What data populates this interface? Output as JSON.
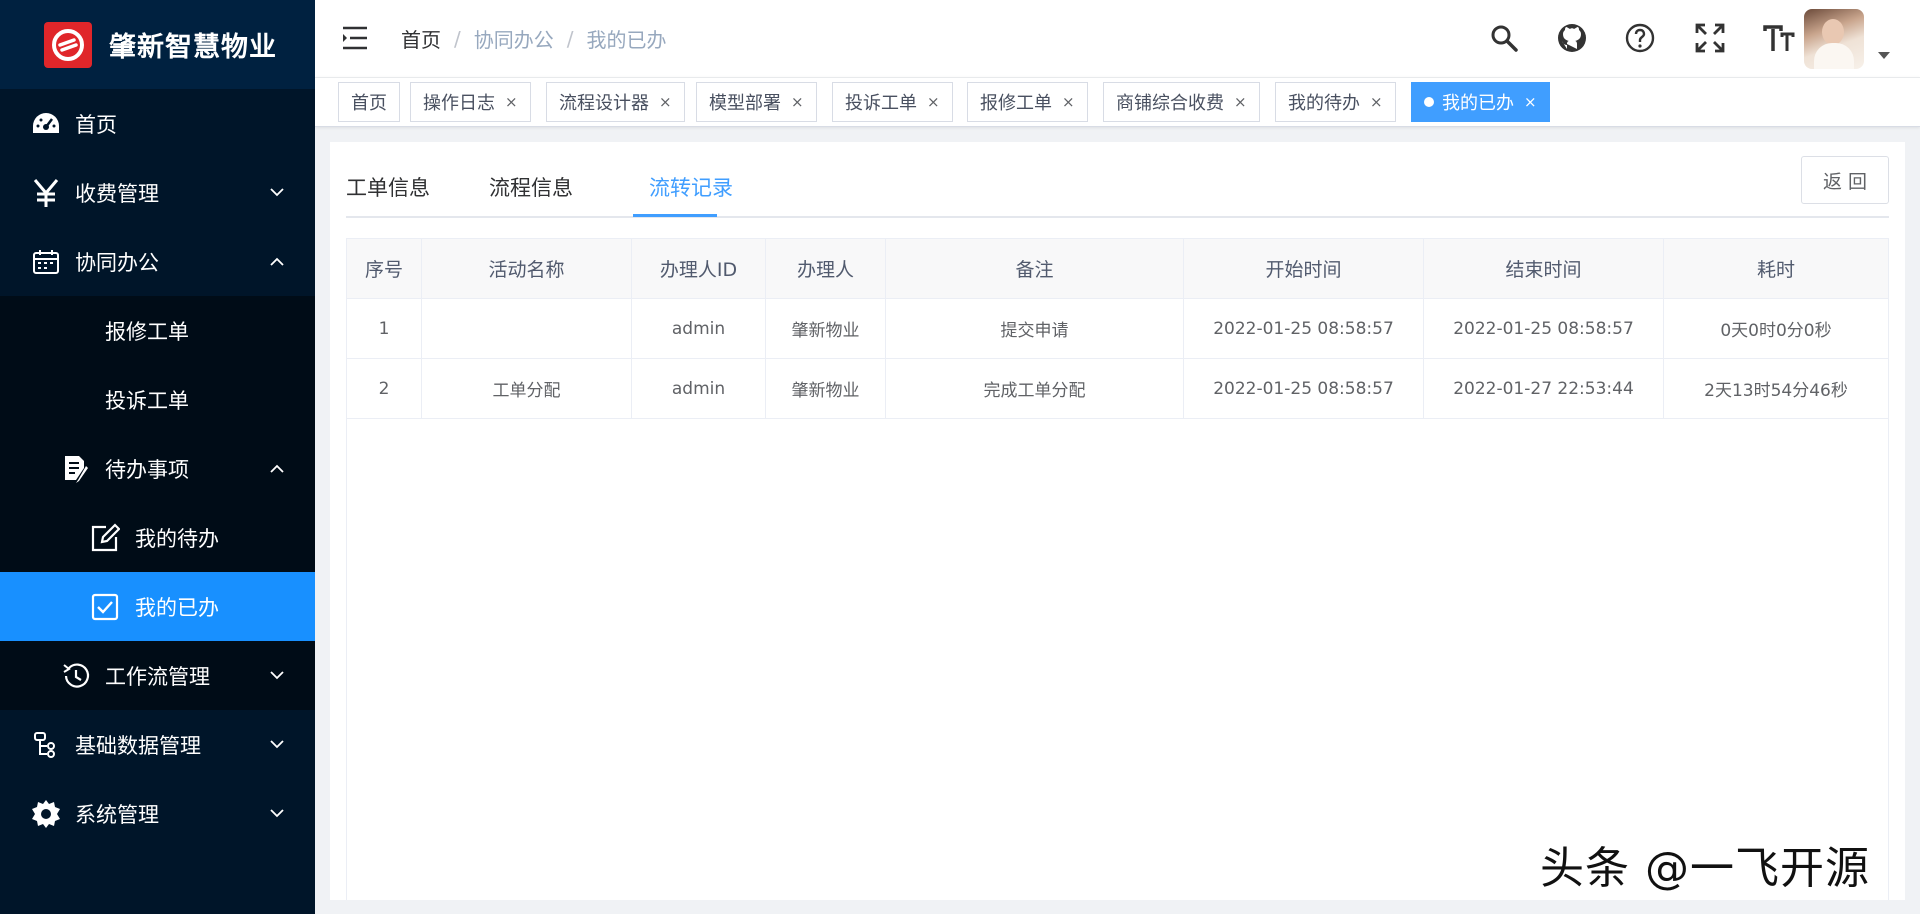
{
  "app": {
    "title": "肇新智慧物业"
  },
  "sidebar": {
    "items": [
      {
        "label": "首页",
        "icon": "dashboard-icon"
      },
      {
        "label": "收费管理",
        "icon": "yen-icon"
      },
      {
        "label": "协同办公",
        "icon": "calendar-icon"
      },
      {
        "label": "报修工单"
      },
      {
        "label": "投诉工单"
      },
      {
        "label": "待办事项",
        "icon": "edit-doc-icon"
      },
      {
        "label": "我的待办",
        "icon": "edit-icon"
      },
      {
        "label": "我的已办",
        "icon": "checkbox-icon"
      },
      {
        "label": "工作流管理",
        "icon": "history-icon"
      },
      {
        "label": "基础数据管理",
        "icon": "tree-icon"
      },
      {
        "label": "系统管理",
        "icon": "gear-icon"
      }
    ],
    "active_color": "#1890ff",
    "bg_color": "#001529"
  },
  "header": {
    "breadcrumb": [
      "首页",
      "协同办公",
      "我的已办"
    ],
    "icons": [
      "search-icon",
      "github-icon",
      "help-icon",
      "fullscreen-icon",
      "font-size-icon"
    ]
  },
  "tags": [
    {
      "label": "首页",
      "closable": false
    },
    {
      "label": "操作日志",
      "closable": true
    },
    {
      "label": "流程设计器",
      "closable": true
    },
    {
      "label": "模型部署",
      "closable": true
    },
    {
      "label": "投诉工单",
      "closable": true
    },
    {
      "label": "报修工单",
      "closable": true
    },
    {
      "label": "商铺综合收费",
      "closable": true
    },
    {
      "label": "我的待办",
      "closable": true
    },
    {
      "label": "我的已办",
      "closable": true,
      "active": true
    }
  ],
  "tag_close": "×",
  "content": {
    "tabs": [
      "工单信息",
      "流程信息",
      "流转记录"
    ],
    "active_tab": "流转记录",
    "back_label": "返 回",
    "table": {
      "headers": [
        "序号",
        "活动名称",
        "办理人ID",
        "办理人",
        "备注",
        "开始时间",
        "结束时间",
        "耗时"
      ],
      "rows": [
        [
          "1",
          "",
          "admin",
          "肇新物业",
          "提交申请",
          "2022-01-25 08:58:57",
          "2022-01-25 08:58:57",
          "0天0时0分0秒"
        ],
        [
          "2",
          "工单分配",
          "admin",
          "肇新物业",
          "完成工单分配",
          "2022-01-25 08:58:57",
          "2022-01-27 22:53:44",
          "2天13时54分46秒"
        ]
      ]
    }
  },
  "watermark": "头条 @一飞开源",
  "accent_color": "#409eff"
}
